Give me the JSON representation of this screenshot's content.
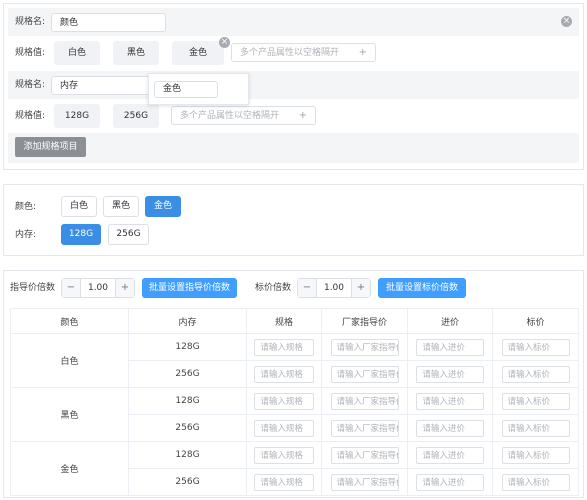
{
  "spec_editor": {
    "groups": [
      {
        "name_label": "规格名:",
        "name_value": "颜色",
        "values_label": "规格值:",
        "values": [
          "白色",
          "黑色",
          "金色"
        ],
        "add_placeholder": "多个产品属性以空格隔开"
      },
      {
        "name_label": "规格名:",
        "name_value": "内存",
        "values_label": "规格值:",
        "values": [
          "128G",
          "256G"
        ],
        "add_placeholder": "多个产品属性以空格隔开"
      }
    ],
    "popup_value": "金色",
    "add_item_label": "添加规格项目",
    "close_glyph": "×",
    "plus_glyph": "+"
  },
  "selector": {
    "rows": [
      {
        "label": "颜色:",
        "options": [
          "白色",
          "黑色",
          "金色"
        ],
        "selected": "金色"
      },
      {
        "label": "内存:",
        "options": [
          "128G",
          "256G"
        ],
        "selected": "128G"
      }
    ]
  },
  "pricing": {
    "guide_multiplier_label": "指导价倍数",
    "guide_multiplier_value": "1.00",
    "guide_batch_button": "批量设置指导价倍数",
    "tag_multiplier_label": "标价倍数",
    "tag_multiplier_value": "1.00",
    "tag_batch_button": "批量设置标价倍数",
    "stepper_minus": "−",
    "stepper_plus": "+",
    "table": {
      "columns": [
        "颜色",
        "内存",
        "规格",
        "厂家指导价",
        "进价",
        "标价"
      ],
      "placeholders": {
        "spec": "请输入规格",
        "guide": "请输入厂家指导价",
        "cost": "请输入进价",
        "tag": "请输入标价"
      },
      "groups": [
        {
          "color": "白色",
          "memories": [
            "128G",
            "256G"
          ]
        },
        {
          "color": "黑色",
          "memories": [
            "128G",
            "256G"
          ]
        },
        {
          "color": "金色",
          "memories": [
            "128G",
            "256G"
          ]
        }
      ]
    }
  },
  "colors": {
    "accent": "#409eff",
    "selected": "#3a8ee6",
    "gray_button": "#8c9096",
    "panel_bg": "#f4f5f7"
  }
}
